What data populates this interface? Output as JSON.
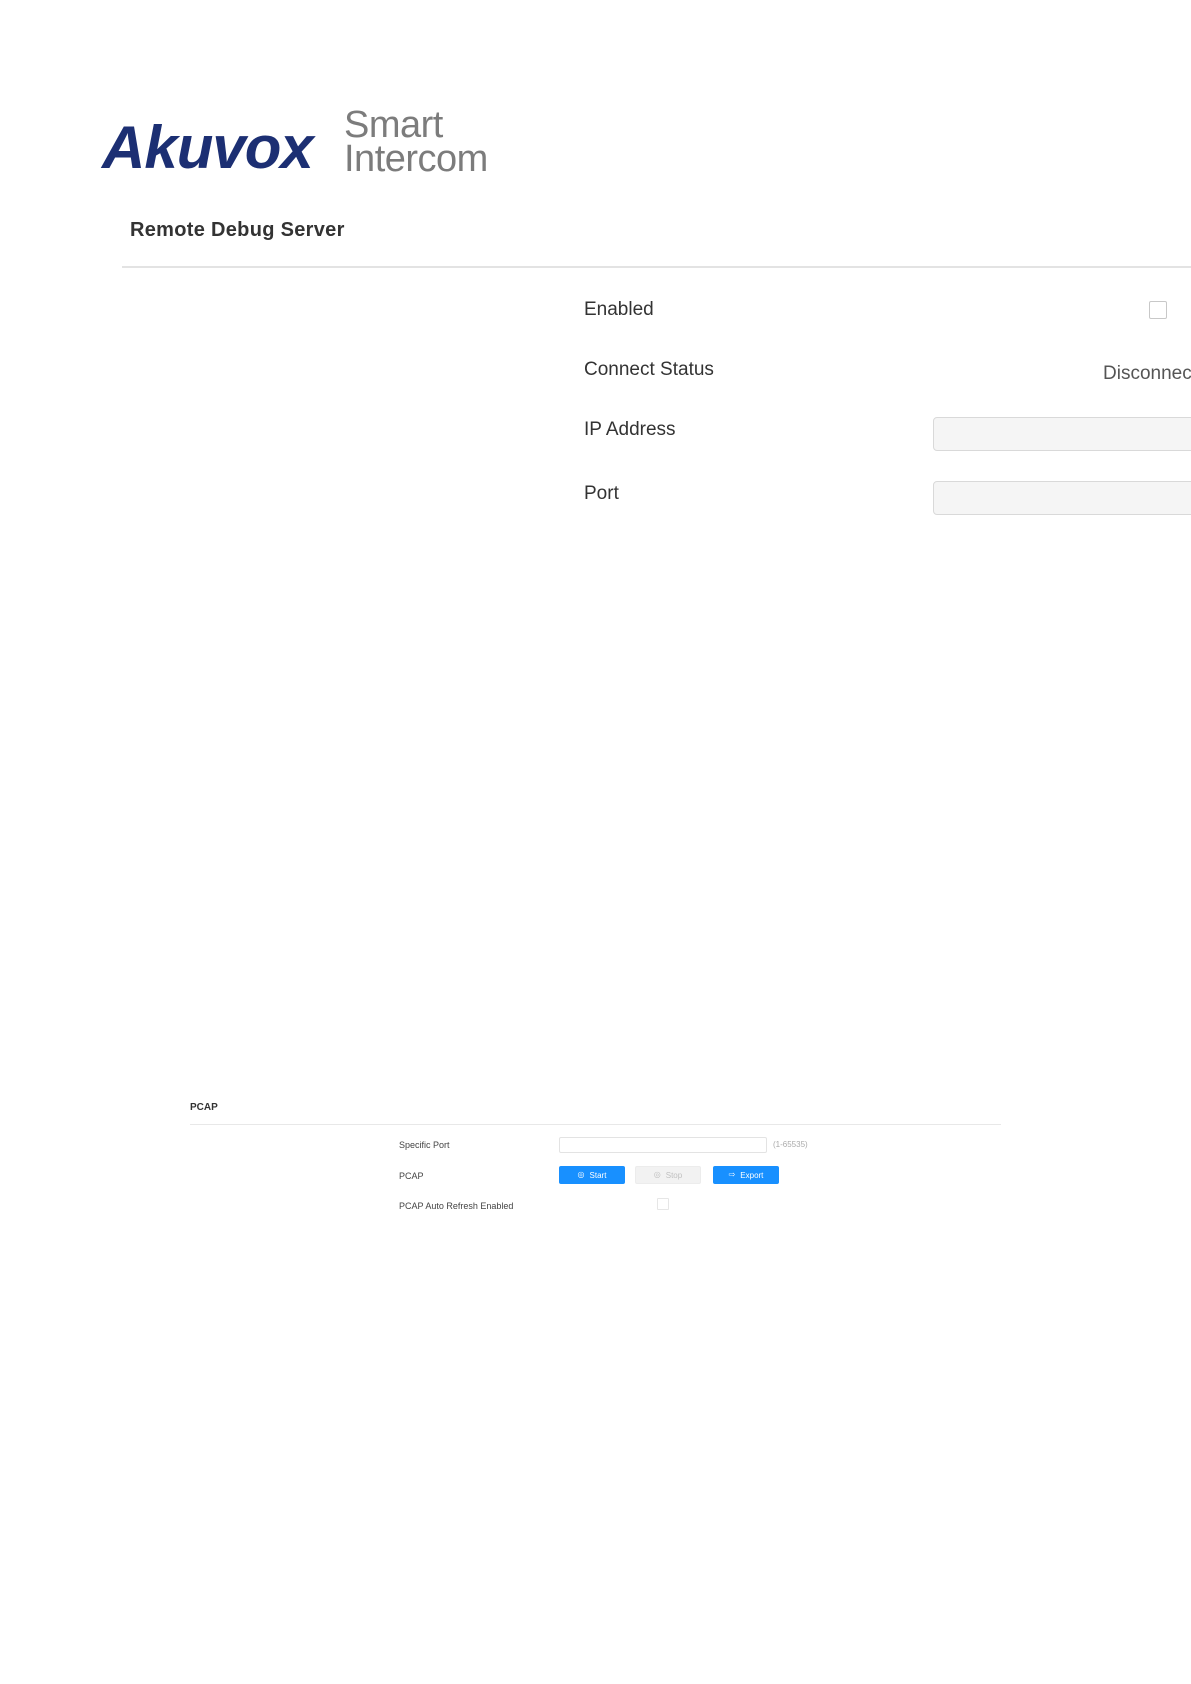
{
  "logo": {
    "brand": "Akuvox",
    "tagline_line1": "Smart",
    "tagline_line2": "Intercom",
    "brand_color": "#1c2f73",
    "tagline_color": "#7c7c7c"
  },
  "remote_debug": {
    "title": "Remote Debug Server",
    "fields": {
      "enabled_label": "Enabled",
      "enabled_checked": false,
      "connect_status_label": "Connect Status",
      "connect_status_value": "Disconnec",
      "ip_label": "IP Address",
      "ip_value": "",
      "port_label": "Port",
      "port_value": ""
    }
  },
  "pcap": {
    "title": "PCAP",
    "specific_port_label": "Specific Port",
    "specific_port_value": "",
    "specific_port_hint": "(1-65535)",
    "pcap_label": "PCAP",
    "buttons": {
      "start": {
        "label": "Start",
        "icon": "play-circle-icon"
      },
      "stop": {
        "label": "Stop",
        "icon": "stop-circle-icon"
      },
      "export": {
        "label": "Export",
        "icon": "export-icon"
      }
    },
    "auto_refresh_label": "PCAP Auto Refresh Enabled",
    "auto_refresh_checked": false,
    "accent_color": "#1890ff"
  }
}
